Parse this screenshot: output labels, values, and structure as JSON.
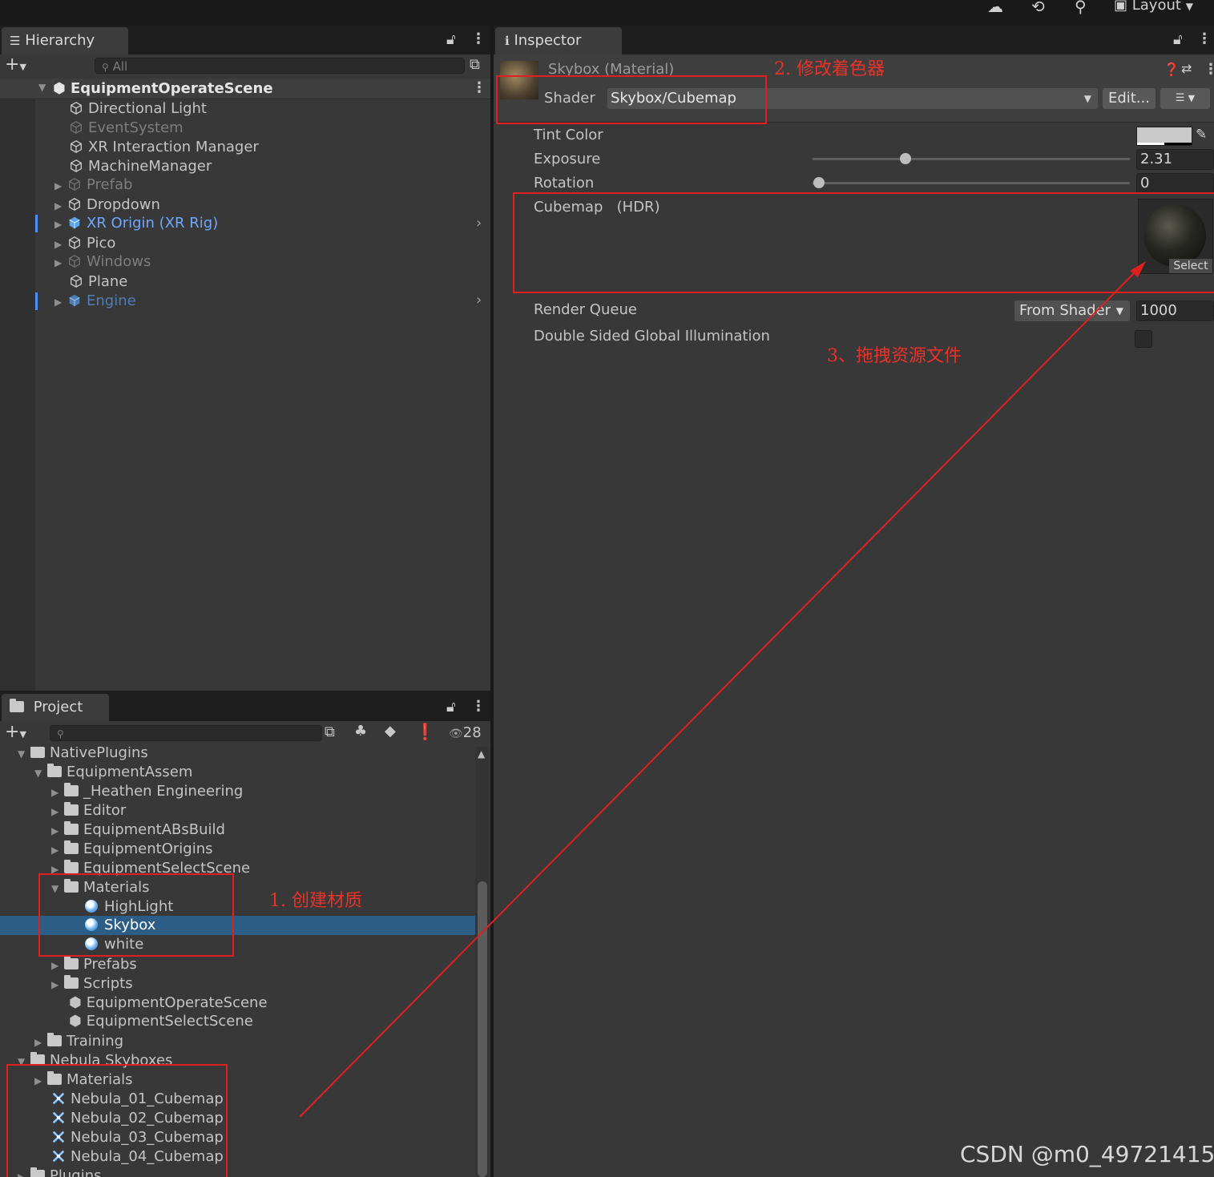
{
  "topbar": {
    "layout_label": "Layout"
  },
  "hierarchy": {
    "tab_label": "Hierarchy",
    "search_placeholder": "All",
    "scene_name": "EquipmentOperateScene",
    "items": [
      {
        "label": "Directional Light"
      },
      {
        "label": "EventSystem"
      },
      {
        "label": "XR Interaction Manager"
      },
      {
        "label": "MachineManager"
      },
      {
        "label": "Prefab"
      },
      {
        "label": "Dropdown"
      },
      {
        "label": "XR Origin (XR Rig)"
      },
      {
        "label": "Pico"
      },
      {
        "label": "Windows"
      },
      {
        "label": "Plane"
      },
      {
        "label": "Engine"
      }
    ]
  },
  "project": {
    "tab_label": "Project",
    "hidden_count": "28",
    "tree": [
      {
        "label": "NativePlugins"
      },
      {
        "label": "EquipmentAssem"
      },
      {
        "label": "_Heathen Engineering"
      },
      {
        "label": "Editor"
      },
      {
        "label": "EquipmentABsBuild"
      },
      {
        "label": "EquipmentOrigins"
      },
      {
        "label": "EquipmentSelectScene"
      },
      {
        "label": "Materials"
      },
      {
        "label": "HighLight"
      },
      {
        "label": "Skybox"
      },
      {
        "label": "white"
      },
      {
        "label": "Prefabs"
      },
      {
        "label": "Scripts"
      },
      {
        "label": "EquipmentOperateScene"
      },
      {
        "label": "EquipmentSelectScene"
      },
      {
        "label": "Training"
      },
      {
        "label": "Nebula Skyboxes"
      },
      {
        "label": "Materials"
      },
      {
        "label": "Nebula_01_Cubemap"
      },
      {
        "label": "Nebula_02_Cubemap"
      },
      {
        "label": "Nebula_03_Cubemap"
      },
      {
        "label": "Nebula_04_Cubemap"
      },
      {
        "label": "Plugins"
      }
    ]
  },
  "inspector": {
    "tab_label": "Inspector",
    "material_title": "Skybox (Material)",
    "shader_label": "Shader",
    "shader_value": "Skybox/Cubemap",
    "edit_label": "Edit...",
    "tint_label": "Tint Color",
    "exposure_label": "Exposure",
    "exposure_value": "2.31",
    "exposure_fraction": 0.29,
    "rotation_label": "Rotation",
    "rotation_value": "0",
    "rotation_fraction": 0,
    "cubemap_label": "Cubemap",
    "cubemap_hdr": "(HDR)",
    "select_label": "Select",
    "render_queue_label": "Render Queue",
    "render_queue_mode": "From Shader",
    "render_queue_value": "1000",
    "dsgi_label": "Double Sided Global Illumination"
  },
  "annotations": {
    "step1": "1. 创建材质",
    "step2": "2. 修改着色器",
    "step3": "3、拖拽资源文件"
  },
  "watermark": "CSDN @m0_49721415",
  "colors": {
    "accent_red": "#e02020",
    "selection_blue": "#2c5d87",
    "link_blue": "#6fa7ff"
  }
}
